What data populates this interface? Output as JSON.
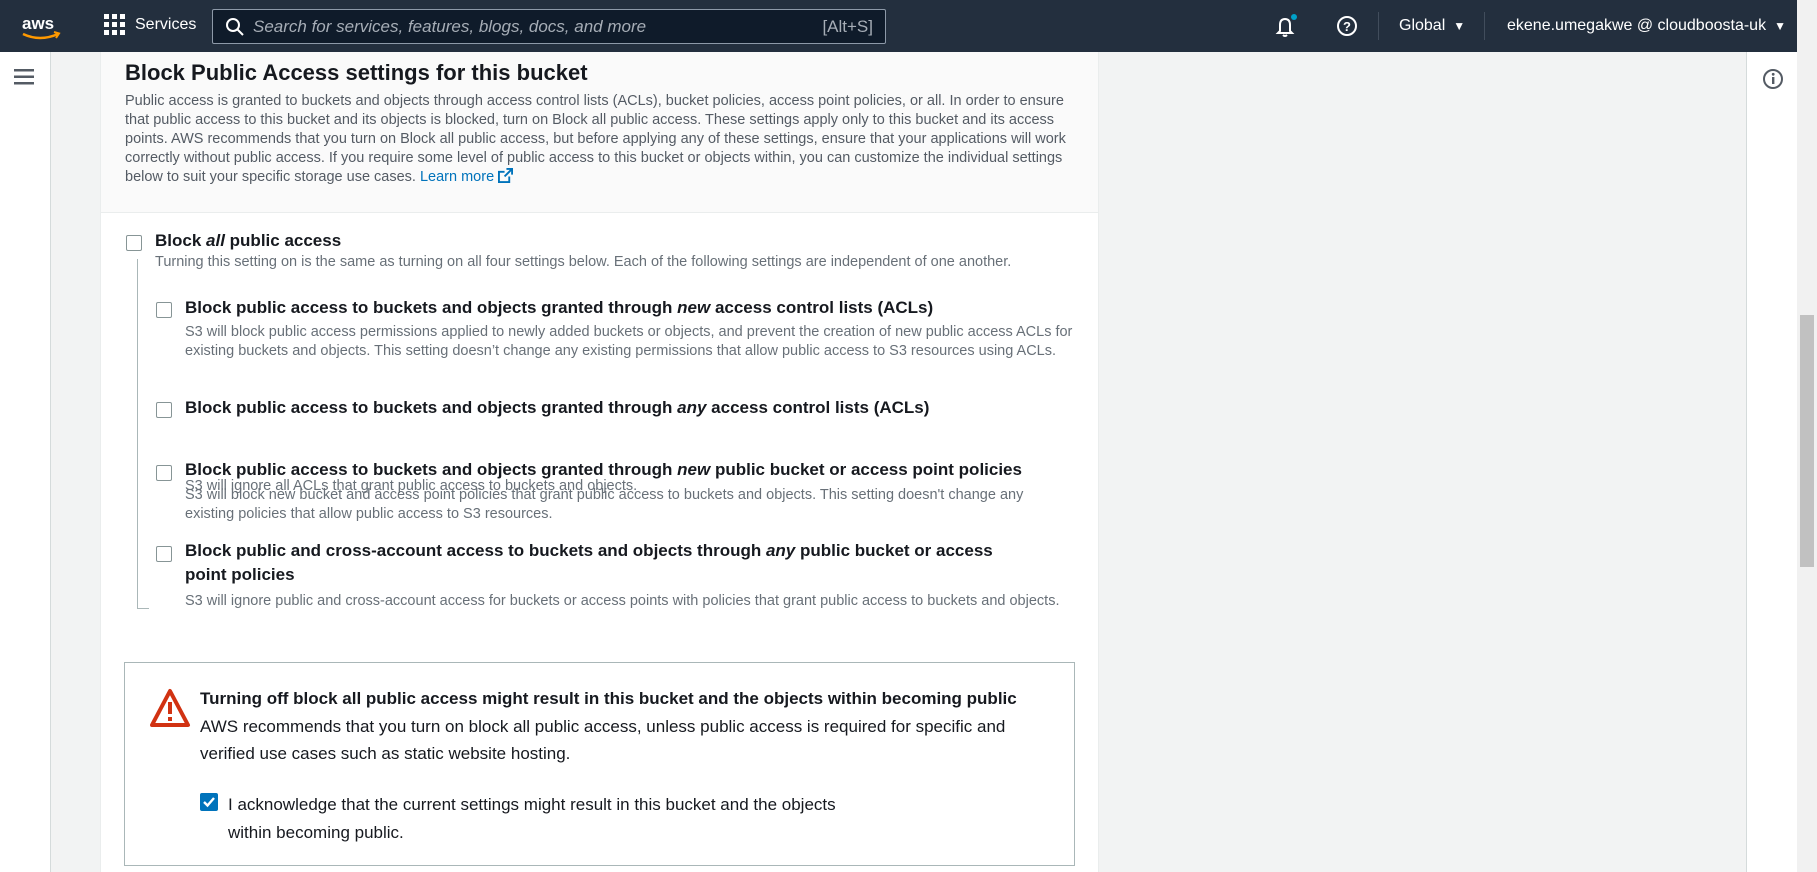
{
  "nav": {
    "services_label": "Services",
    "search_placeholder": "Search for services, features, blogs, docs, and more",
    "search_shortcut": "[Alt+S]",
    "region": "Global",
    "account": "ekene.umegakwe @ cloudboosta-uk",
    "colors": {
      "bg": "#232f3e",
      "accent": "#ff9900",
      "notification_dot": "#00a1c9"
    }
  },
  "section": {
    "title": "Block Public Access settings for this bucket",
    "description": "Public access is granted to buckets and objects through access control lists (ACLs), bucket policies, access point policies, or all. In order to ensure that public access to this bucket and its objects is blocked, turn on Block all public access. These settings apply only to this bucket and its access points. AWS recommends that you turn on Block all public access, but before applying any of these settings, ensure that your applications will work correctly without public access. If you require some level of public access to this bucket or objects within, you can customize the individual settings below to suit your specific storage use cases.",
    "learn_more": "Learn more"
  },
  "block_all": {
    "label_pre": "Block ",
    "label_em": "all",
    "label_post": " public access",
    "description": "Turning this setting on is the same as turning on all four settings below. Each of the following settings are independent of one another.",
    "checked": false
  },
  "options": [
    {
      "pre": "Block public access to buckets and objects granted through ",
      "em": "new",
      "post": " access control lists (ACLs)",
      "description": "S3 will block public access permissions applied to newly added buckets or objects, and prevent the creation of new public access ACLs for existing buckets and objects. This setting doesn’t change any existing permissions that allow public access to S3 resources using ACLs.",
      "checked": false
    },
    {
      "pre": "Block public access to buckets and objects granted through ",
      "em": "any",
      "post": " access control lists (ACLs)",
      "description": "S3 will ignore all ACLs that grant public access to buckets and objects.",
      "checked": false
    },
    {
      "pre": "Block public access to buckets and objects granted through ",
      "em": "new",
      "post": " public bucket or access point policies",
      "description": "S3 will block new bucket and access point policies that grant public access to buckets and objects. This setting doesn't change any existing policies that allow public access to S3 resources.",
      "checked": false
    },
    {
      "pre": "Block public and cross-account access to buckets and objects through ",
      "em": "any",
      "post": " public bucket or access point policies",
      "description": "S3 will ignore public and cross-account access for buckets or access points with policies that grant public access to buckets and objects.",
      "checked": false
    }
  ],
  "warning": {
    "title": "Turning off block all public access might result in this bucket and the objects within becoming public",
    "description": "AWS recommends that you turn on block all public access, unless public access is required for specific and verified use cases such as static website hosting.",
    "acknowledge": "I acknowledge that the current settings might result in this bucket and the objects within becoming public.",
    "acknowledged": true,
    "icon_color": "#d13212"
  }
}
